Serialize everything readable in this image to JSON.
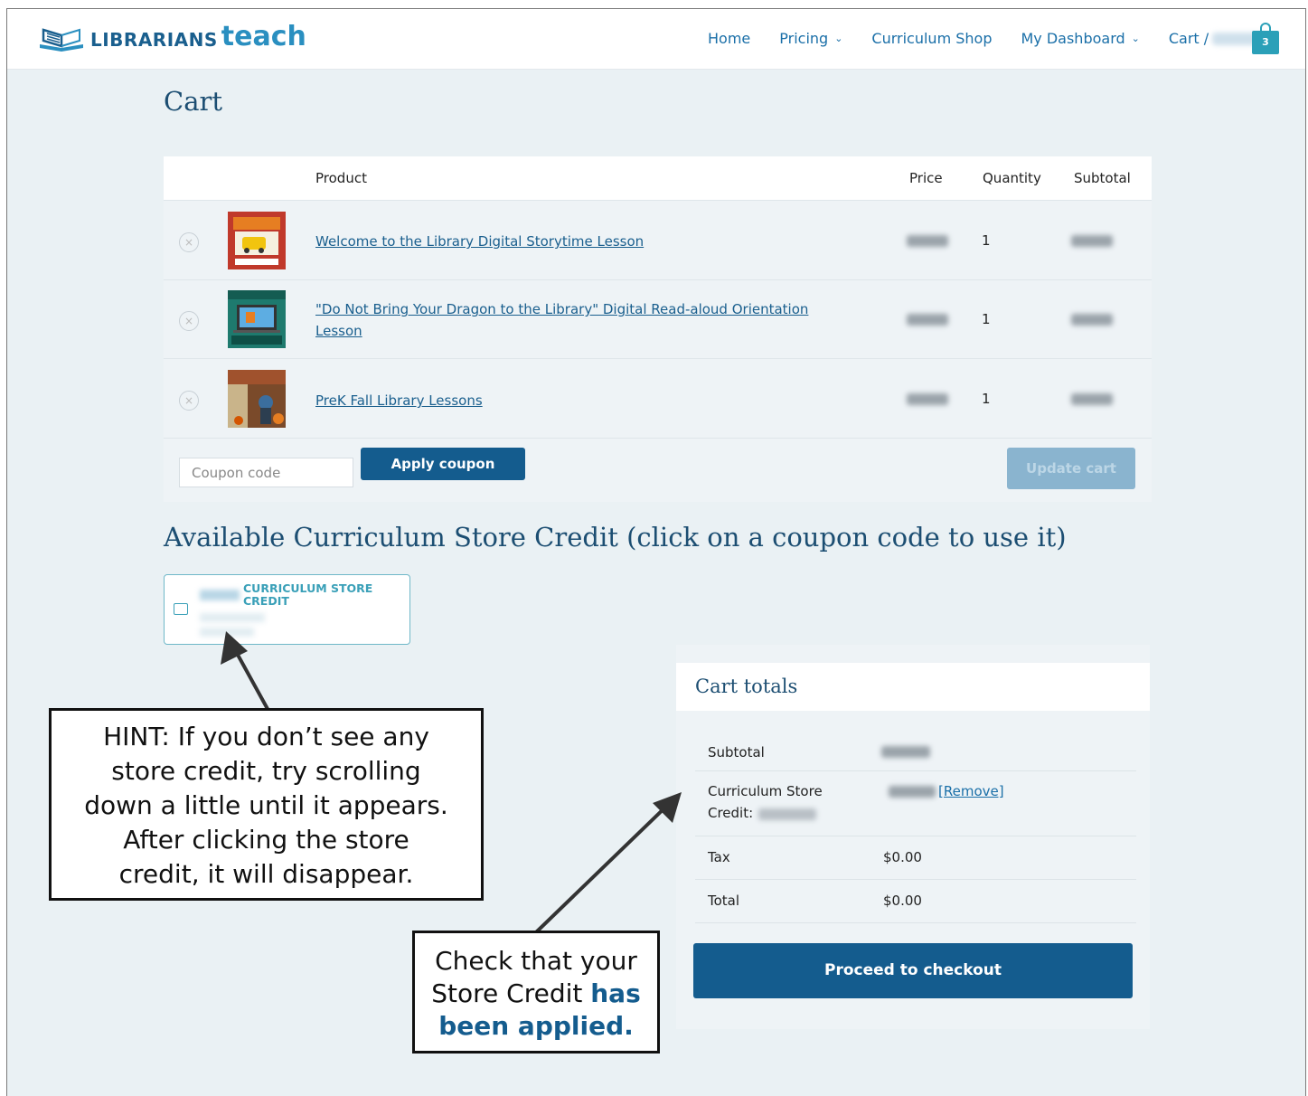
{
  "header": {
    "logo_word1": "LIBRARIANS",
    "logo_word2": "teach",
    "nav": [
      {
        "label": "Home",
        "dropdown": false
      },
      {
        "label": "Pricing",
        "dropdown": true
      },
      {
        "label": "Curriculum Shop",
        "dropdown": false
      },
      {
        "label": "My Dashboard",
        "dropdown": true
      }
    ],
    "cart_label": "Cart /",
    "cart_count": "3"
  },
  "page_title": "Cart",
  "table": {
    "headers": {
      "product": "Product",
      "price": "Price",
      "quantity": "Quantity",
      "subtotal": "Subtotal"
    },
    "items": [
      {
        "name": "Welcome to the Library Digital Storytime Lesson",
        "quantity": "1",
        "thumb_text": "DIGITAL STORYTIME"
      },
      {
        "name": "\"Do Not Bring Your Dragon to the Library\" Digital Read-aloud Orientation Lesson",
        "quantity": "1",
        "thumb_text": "Digital Read-aloud"
      },
      {
        "name": "PreK Fall Library Lessons",
        "quantity": "1",
        "thumb_text": "Fall PreK Library Lessons"
      }
    ],
    "coupon_placeholder": "Coupon code",
    "apply_coupon": "Apply coupon",
    "update_cart": "Update cart"
  },
  "credit_heading": "Available Curriculum Store Credit (click on a coupon code to use it)",
  "credit_card_title": "CURRICULUM STORE CREDIT",
  "totals": {
    "title": "Cart totals",
    "subtotal_label": "Subtotal",
    "credit_label_1": "Curriculum Store",
    "credit_label_2": "Credit:",
    "remove": "[Remove]",
    "tax_label": "Tax",
    "tax_value": "$0.00",
    "total_label": "Total",
    "total_value": "$0.00",
    "checkout": "Proceed to checkout"
  },
  "callouts": {
    "hint_lines": [
      "HINT: If you don’t see any",
      "store credit, try scrolling",
      "down a little until it appears.",
      "After clicking the store",
      "credit, it will disappear."
    ],
    "check_line1": "Check that your",
    "check_line2a": "Store Credit ",
    "check_line2b": "has",
    "check_line3": "been applied."
  },
  "colors": {
    "accent": "#145c8e",
    "teal": "#2ba0b8",
    "background": "#eaf1f4"
  }
}
